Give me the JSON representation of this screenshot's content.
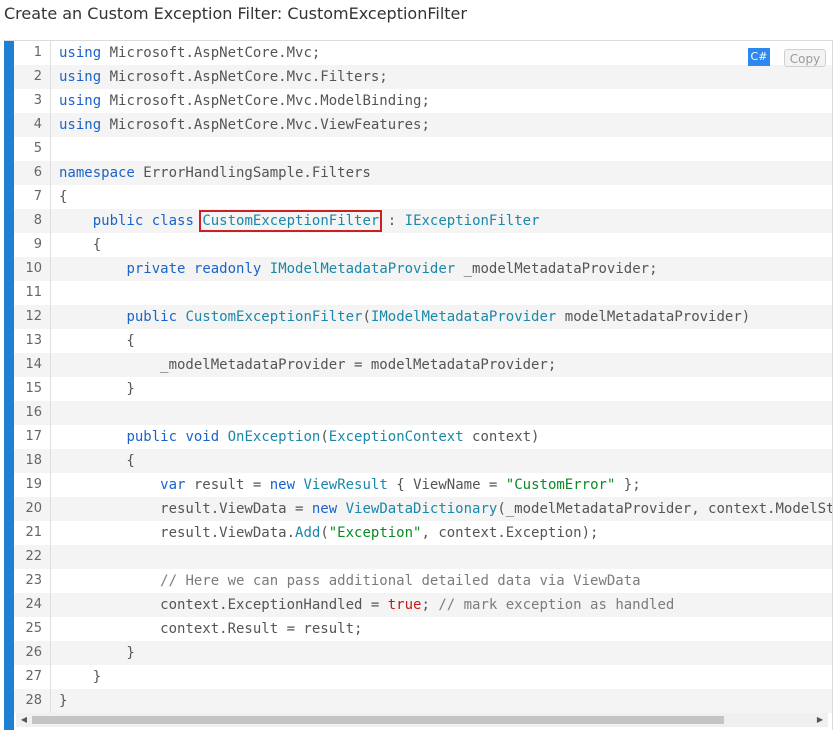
{
  "title": "Create an Custom Exception Filter: CustomExceptionFilter",
  "toolbar": {
    "language": "C#",
    "copy_label": "Copy"
  },
  "code": {
    "lines": [
      [
        {
          "t": "using",
          "c": "kw"
        },
        {
          "t": " Microsoft.AspNetCore.Mvc;"
        }
      ],
      [
        {
          "t": "using",
          "c": "kw"
        },
        {
          "t": " Microsoft.AspNetCore.Mvc.Filters;"
        }
      ],
      [
        {
          "t": "using",
          "c": "kw"
        },
        {
          "t": " Microsoft.AspNetCore.Mvc.ModelBinding;"
        }
      ],
      [
        {
          "t": "using",
          "c": "kw"
        },
        {
          "t": " Microsoft.AspNetCore.Mvc.ViewFeatures;"
        }
      ],
      [],
      [
        {
          "t": "namespace",
          "c": "kw"
        },
        {
          "t": " ErrorHandlingSample.Filters"
        }
      ],
      [
        {
          "t": "{"
        }
      ],
      [
        {
          "t": "    "
        },
        {
          "t": "public",
          "c": "kw"
        },
        {
          "t": " "
        },
        {
          "t": "class",
          "c": "kw"
        },
        {
          "t": " "
        },
        {
          "t": "CustomExceptionFilter",
          "c": "ty",
          "hl": true
        },
        {
          "t": " : "
        },
        {
          "t": "IExceptionFilter",
          "c": "ty"
        }
      ],
      [
        {
          "t": "    {"
        }
      ],
      [
        {
          "t": "        "
        },
        {
          "t": "private",
          "c": "kw"
        },
        {
          "t": " "
        },
        {
          "t": "readonly",
          "c": "kw"
        },
        {
          "t": " "
        },
        {
          "t": "IModelMetadataProvider",
          "c": "ty"
        },
        {
          "t": " _modelMetadataProvider;"
        }
      ],
      [],
      [
        {
          "t": "        "
        },
        {
          "t": "public",
          "c": "kw"
        },
        {
          "t": " "
        },
        {
          "t": "CustomExceptionFilter",
          "c": "ty"
        },
        {
          "t": "("
        },
        {
          "t": "IModelMetadataProvider",
          "c": "ty"
        },
        {
          "t": " modelMetadataProvider)"
        }
      ],
      [
        {
          "t": "        {"
        }
      ],
      [
        {
          "t": "            _modelMetadataProvider = modelMetadataProvider;"
        }
      ],
      [
        {
          "t": "        }"
        }
      ],
      [],
      [
        {
          "t": "        "
        },
        {
          "t": "public",
          "c": "kw"
        },
        {
          "t": " "
        },
        {
          "t": "void",
          "c": "kw"
        },
        {
          "t": " "
        },
        {
          "t": "OnException",
          "c": "ty"
        },
        {
          "t": "("
        },
        {
          "t": "ExceptionContext",
          "c": "ty"
        },
        {
          "t": " context)"
        }
      ],
      [
        {
          "t": "        {"
        }
      ],
      [
        {
          "t": "            "
        },
        {
          "t": "var",
          "c": "kw"
        },
        {
          "t": " result = "
        },
        {
          "t": "new",
          "c": "kw"
        },
        {
          "t": " "
        },
        {
          "t": "ViewResult",
          "c": "ty"
        },
        {
          "t": " { ViewName = "
        },
        {
          "t": "\"CustomError\"",
          "c": "str"
        },
        {
          "t": " };"
        }
      ],
      [
        {
          "t": "            result.ViewData = "
        },
        {
          "t": "new",
          "c": "kw"
        },
        {
          "t": " "
        },
        {
          "t": "ViewDataDictionary",
          "c": "ty"
        },
        {
          "t": "(_modelMetadataProvider, context.ModelState);"
        }
      ],
      [
        {
          "t": "            result.ViewData."
        },
        {
          "t": "Add",
          "c": "ty"
        },
        {
          "t": "("
        },
        {
          "t": "\"Exception\"",
          "c": "str"
        },
        {
          "t": ", context.Exception);"
        }
      ],
      [],
      [
        {
          "t": "            "
        },
        {
          "t": "// Here we can pass additional detailed data via ViewData",
          "c": "com"
        }
      ],
      [
        {
          "t": "            context.ExceptionHandled = "
        },
        {
          "t": "true",
          "c": "lit"
        },
        {
          "t": "; "
        },
        {
          "t": "// mark exception as handled",
          "c": "com"
        }
      ],
      [
        {
          "t": "            context.Result = result;"
        }
      ],
      [
        {
          "t": "        }"
        }
      ],
      [
        {
          "t": "    }"
        }
      ],
      [
        {
          "t": "}"
        }
      ]
    ]
  }
}
